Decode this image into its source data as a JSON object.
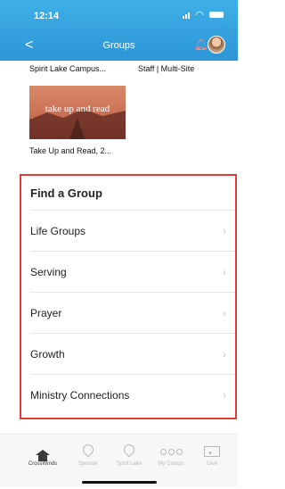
{
  "status": {
    "time": "12:14"
  },
  "nav": {
    "back": "<",
    "title": "Groups"
  },
  "campus_row": {
    "left": "Spirit Lake Campus...",
    "right": "Staff | Multi-Site"
  },
  "image_card": {
    "overlay_text": "take up and read",
    "caption": "Take Up and Read, 2..."
  },
  "find_group": {
    "title": "Find a Group",
    "items": [
      {
        "label": "Life Groups"
      },
      {
        "label": "Serving"
      },
      {
        "label": "Prayer"
      },
      {
        "label": "Growth"
      },
      {
        "label": "Ministry Connections"
      }
    ]
  },
  "tabs": [
    {
      "label": "CrossWinds",
      "icon": "home-icon",
      "active": true
    },
    {
      "label": "Spencer",
      "icon": "location-pin-icon",
      "active": false
    },
    {
      "label": "Spirit Lake",
      "icon": "location-pin-icon",
      "active": false
    },
    {
      "label": "My Groups",
      "icon": "people-icon",
      "active": false
    },
    {
      "label": "Give",
      "icon": "give-icon",
      "active": false
    }
  ],
  "colors": {
    "header": "#2c95d6",
    "highlight": "#e53935",
    "tab_inactive": "#b9b9b9",
    "tab_active": "#3a3a3a"
  }
}
